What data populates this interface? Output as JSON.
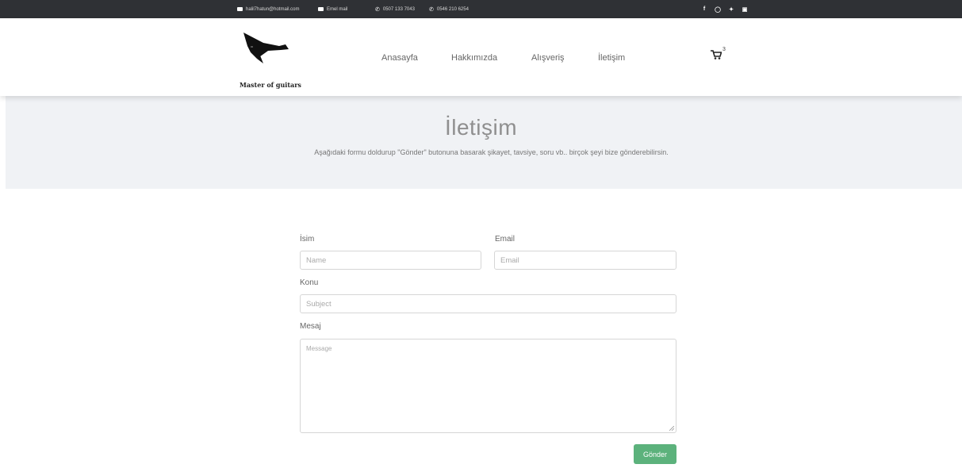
{
  "topbar": {
    "email": "halil7hatun@hotmail.com",
    "email_link": "Emel mail",
    "phone1": "0507 133 7043",
    "phone2": "0546 210 6254",
    "social_icons": [
      "facebook-icon",
      "instagram-icon",
      "twitter-icon",
      "linkedin-icon"
    ]
  },
  "header": {
    "logo_text": "Master of guitars",
    "nav": [
      "Anasayfa",
      "Hakkımızda",
      "Alışveriş",
      "İletişim"
    ],
    "cart_count": "3"
  },
  "hero": {
    "title": "İletişim",
    "subtitle": "Aşağıdaki formu doldurup \"Gönder\" butonuna basarak şikayet, tavsiye, soru vb.. birçok şeyi bize gönderebilirsin."
  },
  "form": {
    "name_label": "İsim",
    "name_placeholder": "Name",
    "email_label": "Email",
    "email_placeholder": "Email",
    "subject_label": "Konu",
    "subject_placeholder": "Subject",
    "message_label": "Mesaj",
    "message_placeholder": "Message",
    "submit_label": "Gönder"
  },
  "colors": {
    "topbar_bg": "#2f3135",
    "hero_bg": "#f0f2f5",
    "accent": "#5cb27c"
  }
}
